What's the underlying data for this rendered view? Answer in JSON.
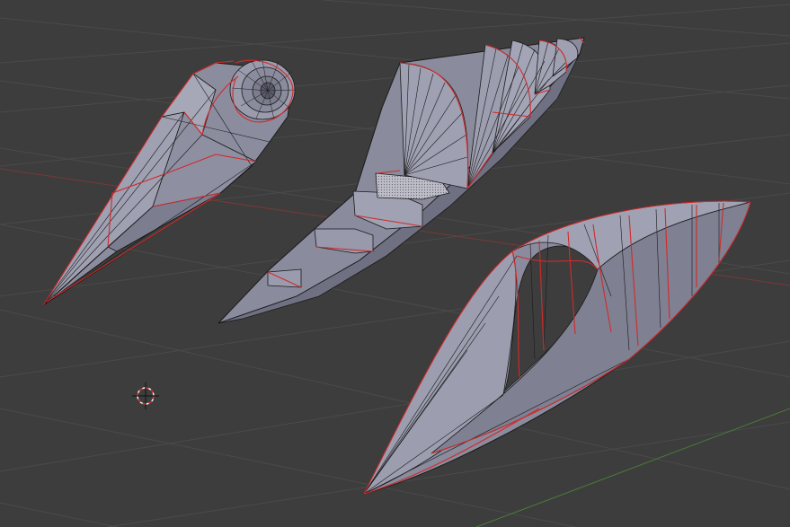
{
  "viewport": {
    "name": "3d-viewport",
    "colors": {
      "background": "#3d3d3d",
      "grid": "#4a4a4a",
      "x_axis": "#8a3a3a",
      "y_axis": "#4d8a3a",
      "mesh_face": "#8a8b9d",
      "mesh_face_light": "#a3a4b4",
      "mesh_face_dark": "#6d6e80",
      "edge": "#1a1a1a",
      "seam": "#d22a2a",
      "cursor": "#e8e8e8",
      "cursor_accent": "#e03030"
    },
    "objects": [
      {
        "name": "cone-mesh-object"
      },
      {
        "name": "stair-fan-mesh-object"
      },
      {
        "name": "leaf-mesh-object"
      }
    ],
    "cursor": {
      "name": "3d-cursor-icon"
    }
  }
}
